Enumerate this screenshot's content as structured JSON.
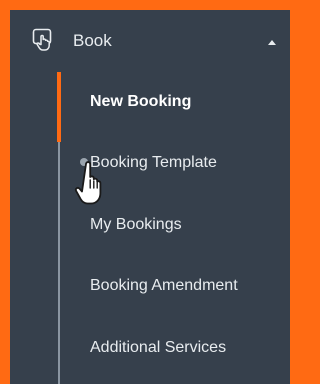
{
  "menu": {
    "title": "Book",
    "icon": "booking-icon",
    "expanded": true,
    "items": [
      {
        "label": "New Booking",
        "active": true
      },
      {
        "label": "Booking Template",
        "active": false
      },
      {
        "label": "My Bookings",
        "active": false
      },
      {
        "label": "Booking Amendment",
        "active": false
      },
      {
        "label": "Additional Services",
        "active": false
      }
    ]
  },
  "colors": {
    "frame": "#ff6a13",
    "panel": "#36404c",
    "text": "#e8ecef",
    "active_indicator": "#ff6a13",
    "track": "#8a95a1"
  },
  "cursor": "hand-pointer-icon"
}
